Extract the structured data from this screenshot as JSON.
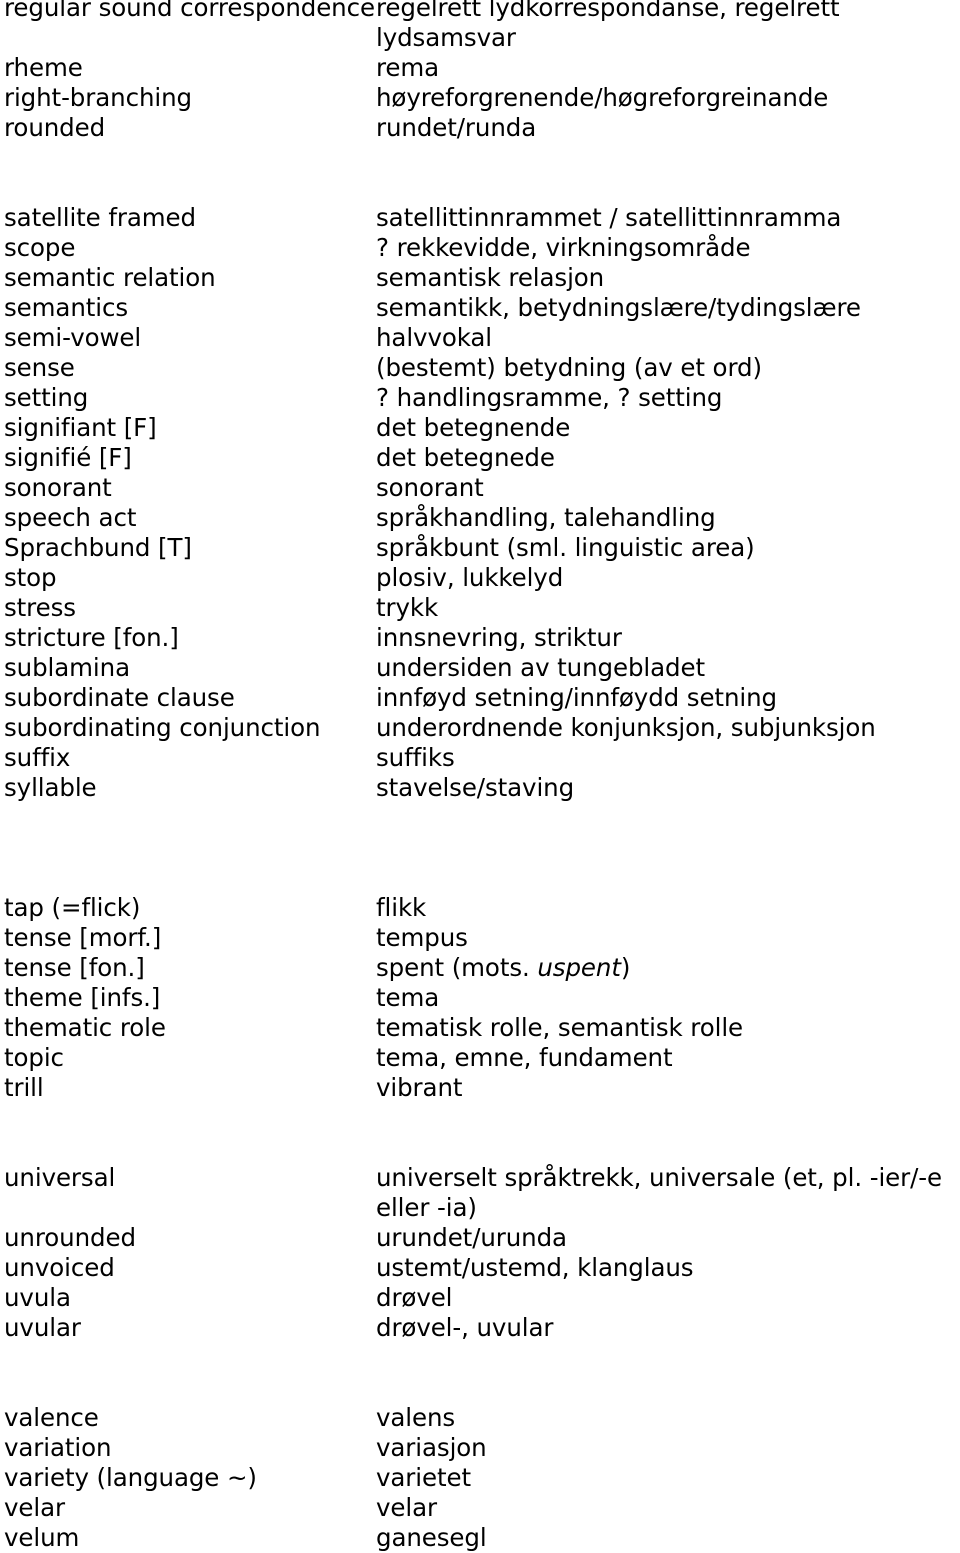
{
  "document": {
    "type": "bilingual-glossary",
    "source_language": "English",
    "target_language": "Norwegian"
  },
  "blocks": [
    {
      "id": "block-r",
      "gap_before": 0,
      "entries": [
        {
          "term": "regular sound correspondence",
          "gloss": "regelrett lydkorrespondanse, regelrett",
          "gloss_cont": "lydsamsvar"
        },
        {
          "term": "rheme",
          "gloss": "rema"
        },
        {
          "term": "right-branching",
          "gloss": "høyreforgrenende/høgreforgreinande"
        },
        {
          "term": "rounded",
          "gloss": "rundet/runda"
        }
      ]
    },
    {
      "id": "block-s",
      "gap_before": 2,
      "entries": [
        {
          "term": "satellite framed",
          "gloss": "satellittinnrammet / satellittinnramma"
        },
        {
          "term": "scope",
          "gloss": "? rekkevidde, virkningsområde"
        },
        {
          "term": "semantic relation",
          "gloss": "semantisk relasjon"
        },
        {
          "term": "semantics",
          "gloss": "semantikk, betydningslære/tydingslære"
        },
        {
          "term": "semi-vowel",
          "gloss": "halvvokal"
        },
        {
          "term": "sense",
          "gloss": "(bestemt) betydning (av et ord)"
        },
        {
          "term": "setting",
          "gloss": "? handlingsramme, ? setting"
        },
        {
          "term": "signifiant [F]",
          "gloss": "det betegnende"
        },
        {
          "term": "signifié [F]",
          "gloss": "det betegnede"
        },
        {
          "term": "sonorant",
          "gloss": "sonorant"
        },
        {
          "term": "speech act",
          "gloss": "språkhandling, talehandling"
        },
        {
          "term": "Sprachbund [T]",
          "gloss": "språkbunt (sml. linguistic area)"
        },
        {
          "term": "stop",
          "gloss": "plosiv, lukkelyd"
        },
        {
          "term": "stress",
          "gloss": "trykk"
        },
        {
          "term": "stricture [fon.]",
          "gloss": "innsnevring, striktur"
        },
        {
          "term": "sublamina",
          "gloss": "undersiden av tungebladet"
        },
        {
          "term": "subordinate clause",
          "gloss": "innføyd setning/innføydd setning"
        },
        {
          "term": "subordinating conjunction",
          "gloss": "underordnende konjunksjon, subjunksjon"
        },
        {
          "term": "suffix",
          "gloss": "suffiks"
        },
        {
          "term": "syllable",
          "gloss": "stavelse/staving"
        }
      ]
    },
    {
      "id": "block-t",
      "gap_before": 3,
      "entries": [
        {
          "term": "tap (=flick)",
          "gloss": "flikk"
        },
        {
          "term": "tense [morf.]",
          "gloss": "tempus"
        },
        {
          "term": "tense [fon.]",
          "gloss": "spent (mots. ",
          "gloss_italic": "uspent",
          "gloss_after": ")"
        },
        {
          "term": "theme [infs.]",
          "gloss": "tema"
        },
        {
          "term": "thematic role",
          "gloss": "tematisk rolle, semantisk rolle"
        },
        {
          "term": "topic",
          "gloss": "tema, emne, fundament"
        },
        {
          "term": "trill",
          "gloss": "vibrant"
        }
      ]
    },
    {
      "id": "block-u",
      "gap_before": 2,
      "entries": [
        {
          "term": "universal",
          "gloss": "universelt språktrekk, universale (et, pl. -ier/-e",
          "gloss_cont": "eller -ia)"
        },
        {
          "term": "unrounded",
          "gloss": "urundet/urunda"
        },
        {
          "term": "unvoiced",
          "gloss": "ustemt/ustemd, klanglaus"
        },
        {
          "term": "uvula",
          "gloss": "drøvel"
        },
        {
          "term": "uvular",
          "gloss": "drøvel-, uvular"
        }
      ]
    },
    {
      "id": "block-v",
      "gap_before": 2,
      "entries": [
        {
          "term": "valence",
          "gloss": "valens"
        },
        {
          "term": "variation",
          "gloss": "variasjon"
        },
        {
          "term": "variety (language ~)",
          "gloss": "varietet"
        },
        {
          "term": "velar",
          "gloss": "velar"
        },
        {
          "term": "velum",
          "gloss": "ganesegl"
        }
      ]
    }
  ]
}
